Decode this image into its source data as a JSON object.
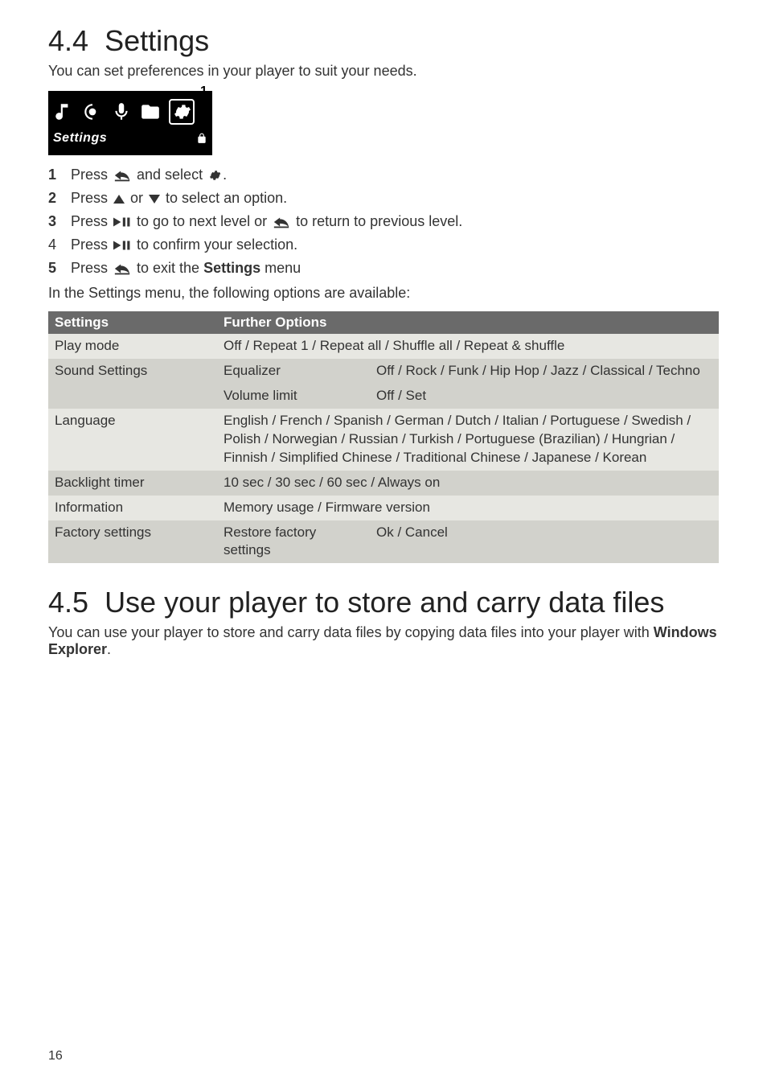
{
  "section1": {
    "number": "4.4",
    "title": "Settings",
    "intro": "You can set preferences in your player to suit your needs.",
    "figure": {
      "marker": "1",
      "screen_label": "Settings"
    },
    "steps": [
      {
        "n": "1",
        "parts": [
          "Press ",
          "{back}",
          " and select ",
          "{gear}",
          "."
        ]
      },
      {
        "n": "2",
        "parts": [
          "Press ",
          "{up}",
          " or ",
          "{down}",
          " to select an option."
        ]
      },
      {
        "n": "3",
        "parts": [
          "Press ",
          "{playpause}",
          " to go to next level or ",
          "{back}",
          " to return to previous level."
        ]
      },
      {
        "n": "4",
        "plain": true,
        "parts": [
          "Press ",
          "{playpause}",
          " to confirm your selection."
        ]
      },
      {
        "n": "5",
        "parts": [
          "Press ",
          "{back}",
          " to exit the ",
          "{b:Settings}",
          " menu"
        ]
      }
    ],
    "context": "In the Settings menu, the following options are available:",
    "table": {
      "header": [
        "Settings",
        "Further Options"
      ],
      "rows": [
        {
          "shade": "light",
          "c1": "Play mode",
          "c2": "",
          "c3": "Off / Repeat 1 / Repeat all / Shuffle all / Repeat & shuffle"
        },
        {
          "shade": "dark",
          "c1": "Sound Settings",
          "c2": "Equalizer",
          "c3": "Off / Rock / Funk / Hip Hop / Jazz / Classical / Techno"
        },
        {
          "shade": "dark",
          "c1": "",
          "c2": "Volume limit",
          "c3": "Off / Set"
        },
        {
          "shade": "light",
          "c1": "Language",
          "c2": "",
          "c3": "English / French / Spanish / German / Dutch / Italian / Portuguese / Swedish / Polish / Norwegian / Russian / Turkish / Portuguese (Brazilian) / Hungrian / Finnish / Simplified Chinese / Traditional Chinese / Japanese / Korean"
        },
        {
          "shade": "dark",
          "c1": "Backlight timer",
          "c2": "",
          "c3": "10 sec / 30 sec / 60 sec / Always on"
        },
        {
          "shade": "light",
          "c1": "Information",
          "c2": "",
          "c3": "Memory usage / Firmware version"
        },
        {
          "shade": "dark",
          "c1": "Factory settings",
          "c2": "Restore factory settings",
          "c3": "Ok / Cancel"
        }
      ]
    }
  },
  "section2": {
    "number": "4.5",
    "title": "Use your player to store and carry data files",
    "body_parts": [
      "You can use your player to store and carry data files by copying data files into your player with ",
      "{b:Windows Explorer}",
      "."
    ]
  },
  "page_number": "16"
}
